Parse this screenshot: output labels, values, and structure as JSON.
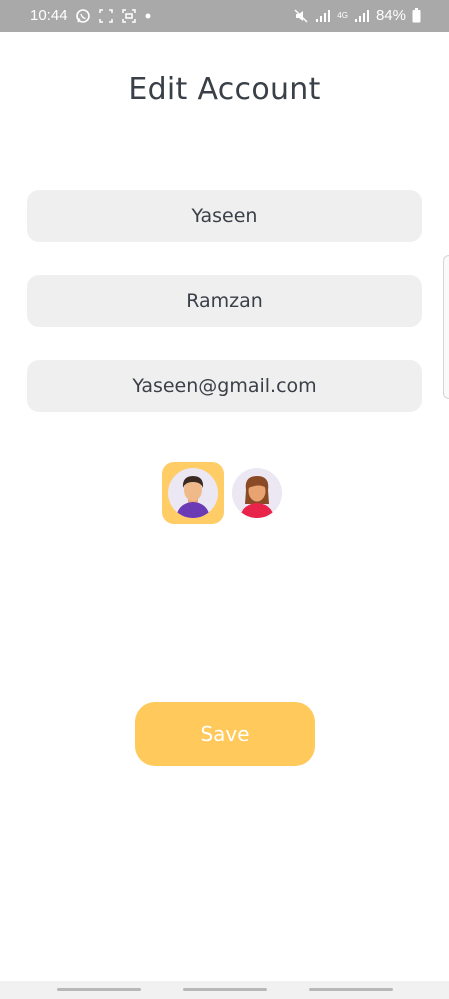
{
  "status_bar": {
    "time": "10:44",
    "battery": "84%",
    "network": "4G",
    "icons": [
      "whatsapp-icon",
      "screenshot-icon",
      "scan-icon",
      "dot-icon",
      "mute-icon",
      "signal-icon",
      "battery-icon"
    ]
  },
  "page": {
    "title": "Edit Account"
  },
  "form": {
    "first_name": "Yaseen",
    "last_name": "Ramzan",
    "email": "Yaseen@gmail.com"
  },
  "avatars": [
    {
      "name": "male-avatar",
      "selected": true
    },
    {
      "name": "female-avatar",
      "selected": false
    }
  ],
  "actions": {
    "save_label": "Save"
  },
  "colors": {
    "accent": "#ffc95b",
    "selected_avatar_bg": "#ffcc66",
    "field_bg": "#efefef",
    "status_bar_bg": "#a9a9a9"
  }
}
